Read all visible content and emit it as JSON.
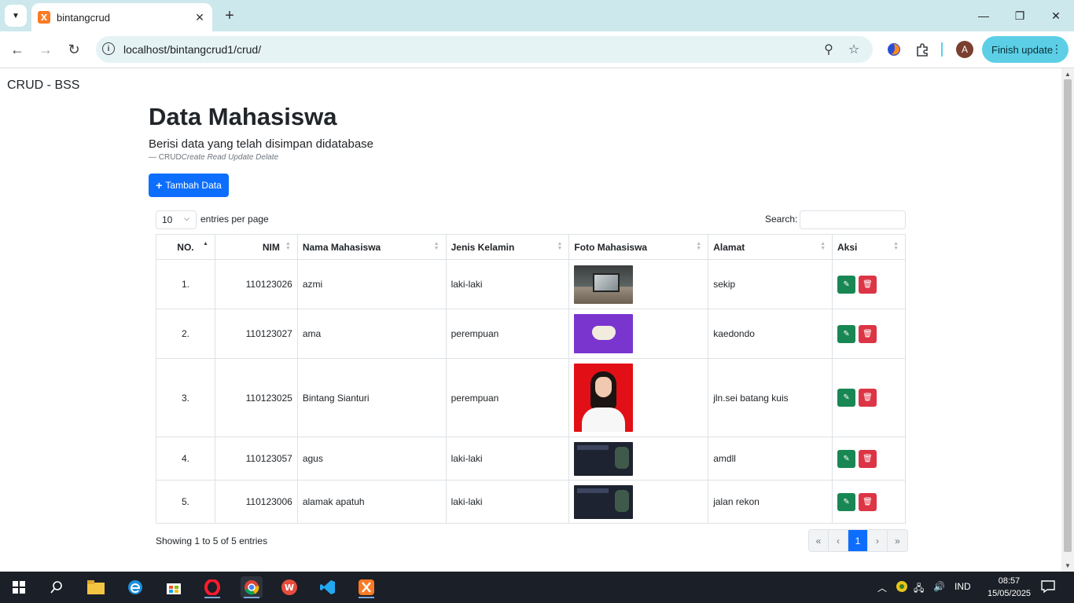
{
  "browser": {
    "tab_title": "bintangcrud",
    "url": "localhost/bintangcrud1/crud/",
    "finish_update_label": "Finish update",
    "profile_initial": "A"
  },
  "page": {
    "brand": "CRUD - BSS",
    "title": "Data Mahasiswa",
    "lead": "Berisi data yang telah disimpan didatabase",
    "cite_prefix": "— CRUD",
    "cite_italic": "Create Read Update Delate",
    "add_button": "Tambah Data"
  },
  "table_controls": {
    "page_length": "10",
    "length_label": "entries per page",
    "search_label": "Search:",
    "search_value": ""
  },
  "table": {
    "columns": [
      "NO.",
      "NIM",
      "Nama Mahasiswa",
      "Jenis Kelamin",
      "Foto Mahasiswa",
      "Alamat",
      "Aksi"
    ],
    "rows": [
      {
        "no": "1.",
        "nim": "110123026",
        "nama": "azmi",
        "jk": "laki-laki",
        "foto": "laptop-photo",
        "alamat": "sekip"
      },
      {
        "no": "2.",
        "nim": "110123027",
        "nama": "ama",
        "jk": "perempuan",
        "foto": "gamepad-photo",
        "alamat": "kaedondo"
      },
      {
        "no": "3.",
        "nim": "110123025",
        "nama": "Bintang Sianturi",
        "jk": "perempuan",
        "foto": "portrait-photo",
        "alamat": "jln.sei batang kuis"
      },
      {
        "no": "4.",
        "nim": "110123057",
        "nama": "agus",
        "jk": "laki-laki",
        "foto": "website-screenshot",
        "alamat": "amdll"
      },
      {
        "no": "5.",
        "nim": "110123006",
        "nama": "alamak apatuh",
        "jk": "laki-laki",
        "foto": "website-screenshot",
        "alamat": "jalan rekon"
      }
    ]
  },
  "footer": {
    "info": "Showing 1 to 5 of 5 entries",
    "pager": [
      "«",
      "‹",
      "1",
      "›",
      "»"
    ],
    "active_page": "1"
  },
  "taskbar": {
    "language": "IND",
    "time": "08:57",
    "date": "15/05/2025"
  },
  "colors": {
    "primary": "#0d6efd",
    "edit": "#198754",
    "delete": "#dc3545",
    "tabstrip": "#cde8ed"
  }
}
